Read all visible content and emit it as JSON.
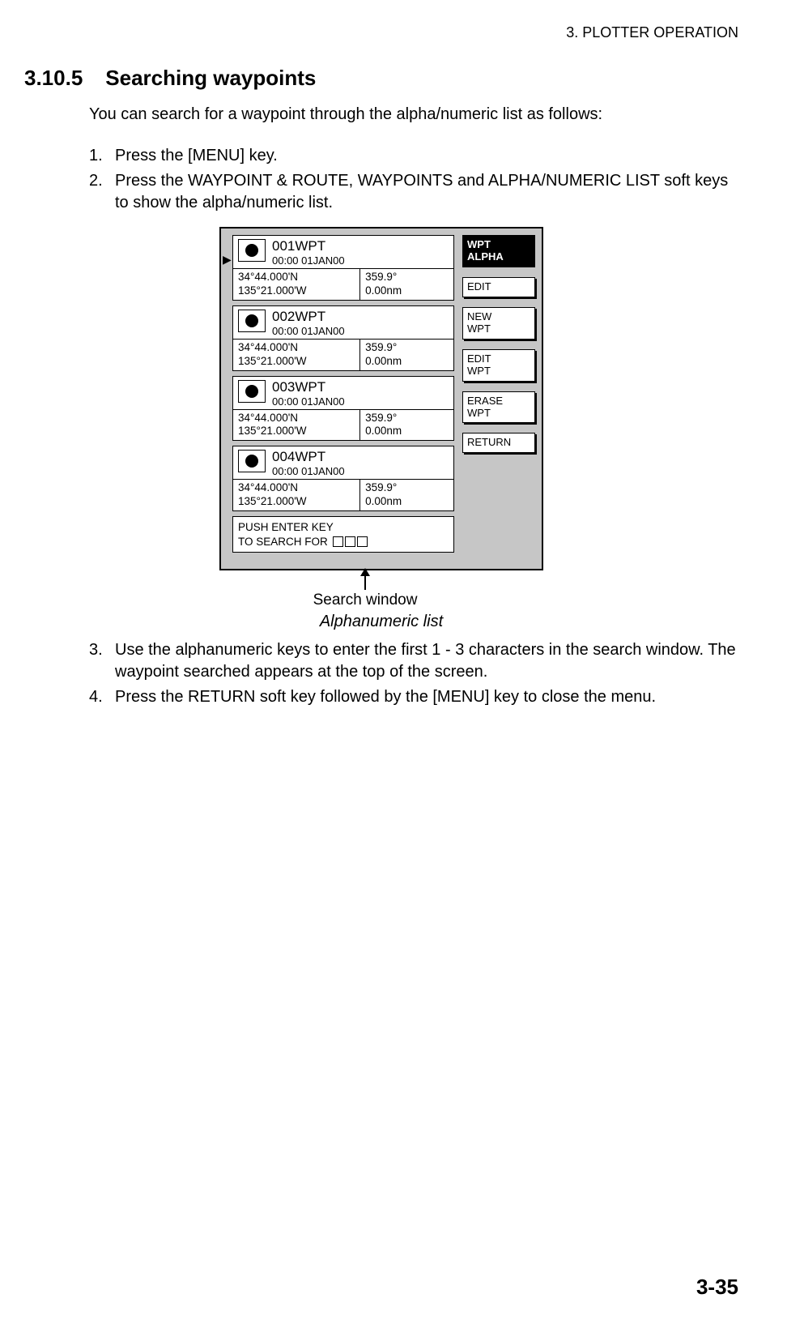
{
  "chapter_header": "3. PLOTTER OPERATION",
  "section": {
    "num": "3.10.5",
    "title": "Searching waypoints"
  },
  "intro": "You can search for a waypoint through the alpha/numeric list as follows:",
  "steps_a": [
    {
      "n": "1.",
      "t": "Press the [MENU] key."
    },
    {
      "n": "2.",
      "t": "Press the WAYPOINT & ROUTE, WAYPOINTS and ALPHA/NUMERIC LIST soft keys to show the alpha/numeric list."
    }
  ],
  "waypoints": [
    {
      "name": "001WPT",
      "time": "00:00 01JAN00",
      "lat": "34°44.000'N",
      "lon": "135°21.000'W",
      "brg": "359.9°",
      "dist": "0.00nm"
    },
    {
      "name": "002WPT",
      "time": "00:00 01JAN00",
      "lat": "34°44.000'N",
      "lon": "135°21.000'W",
      "brg": "359.9°",
      "dist": "0.00nm"
    },
    {
      "name": "003WPT",
      "time": "00:00 01JAN00",
      "lat": "34°44.000'N",
      "lon": "135°21.000'W",
      "brg": "359.9°",
      "dist": "0.00nm"
    },
    {
      "name": "004WPT",
      "time": "00:00 01JAN00",
      "lat": "34°44.000'N",
      "lon": "135°21.000'W",
      "brg": "359.9°",
      "dist": "0.00nm"
    }
  ],
  "search_prompt": {
    "line1": "PUSH ENTER KEY",
    "line2": "TO SEARCH FOR"
  },
  "softkeys": [
    {
      "label": "WPT\nALPHA",
      "active": true
    },
    {
      "label": "EDIT",
      "active": false
    },
    {
      "label": "NEW\nWPT",
      "active": false
    },
    {
      "label": "EDIT\nWPT",
      "active": false
    },
    {
      "label": "ERASE\nWPT",
      "active": false
    },
    {
      "label": "RETURN",
      "active": false
    }
  ],
  "callout": "Search window",
  "caption": "Alphanumeric list",
  "steps_b": [
    {
      "n": "3.",
      "t": "Use the alphanumeric keys to enter the first 1 - 3 characters in the search window. The waypoint searched appears at the top of the screen."
    },
    {
      "n": "4.",
      "t": "Press the RETURN soft key followed by the [MENU] key to close the menu."
    }
  ],
  "page_num": "3-35"
}
